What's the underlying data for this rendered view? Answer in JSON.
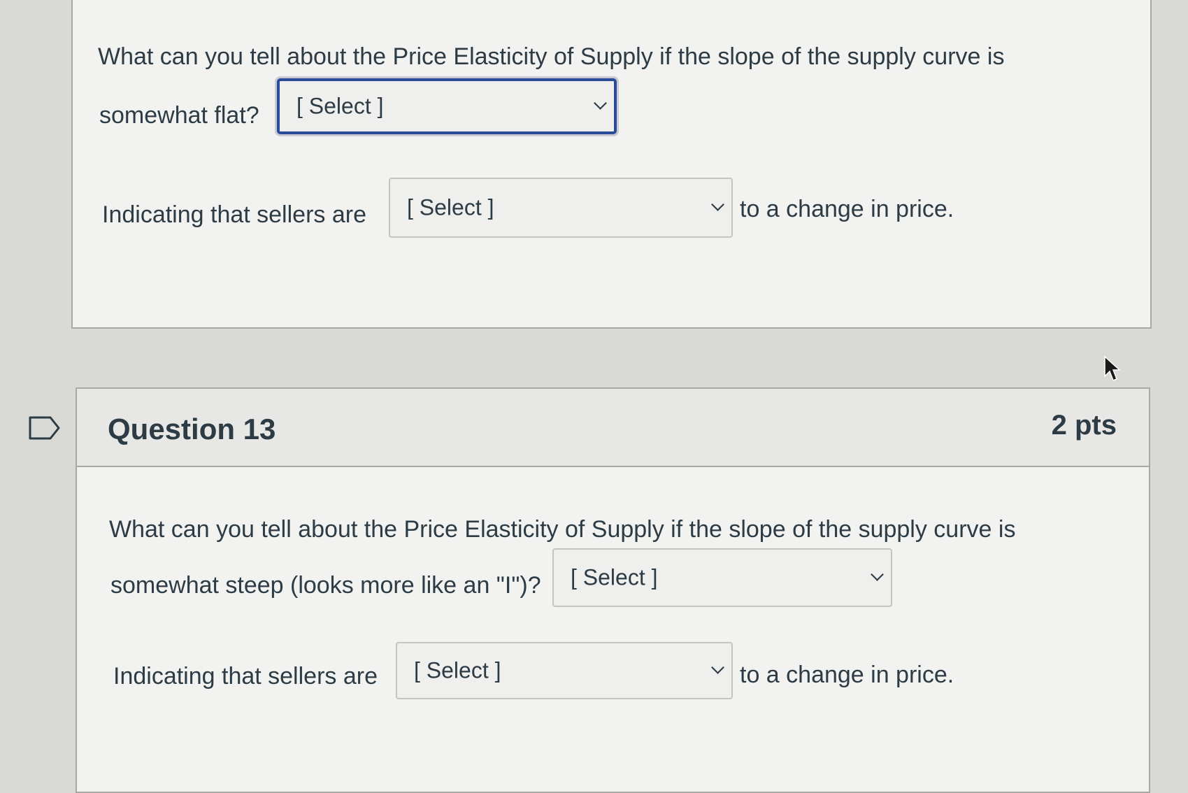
{
  "question12": {
    "prompt_line1": "What can you tell about the Price Elasticity of Supply if the slope of the supply curve is",
    "prompt_line2": "somewhat flat?",
    "select1_value": "[ Select ]",
    "indicating_prefix": "Indicating that sellers are",
    "select2_value": "[ Select ]",
    "indicating_suffix": "to a change in price."
  },
  "question13": {
    "title": "Question 13",
    "points": "2 pts",
    "prompt_line1": "What can you tell about the Price Elasticity of Supply if the slope of the supply curve is",
    "prompt_line2": "somewhat steep (looks more like an \"I\")?",
    "select1_value": "[ Select ]",
    "indicating_prefix": "Indicating that sellers are",
    "select2_value": "[ Select ]",
    "indicating_suffix": "to a change in price."
  },
  "icons": {
    "flag": "flag-question-icon",
    "cursor": "mouse-pointer-icon"
  },
  "colors": {
    "focus_border": "#2c4a9a",
    "text": "#2d3b45",
    "card_background": "#f2f2f1",
    "header_background": "#e7e7e5"
  }
}
